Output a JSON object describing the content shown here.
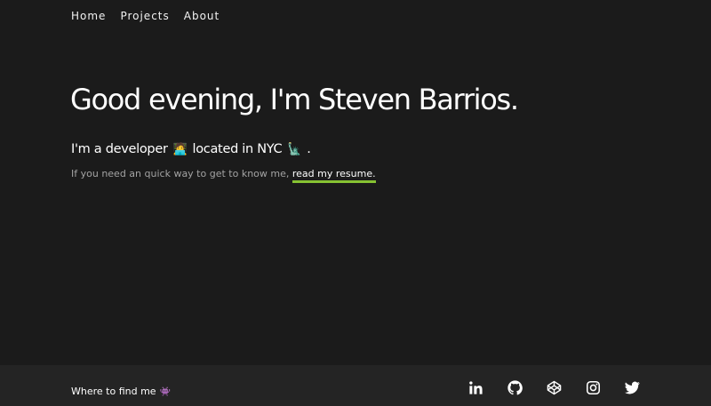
{
  "nav": {
    "items": [
      {
        "label": "Home"
      },
      {
        "label": "Projects"
      },
      {
        "label": "About"
      }
    ]
  },
  "hero": {
    "title": "Good evening, I'm Steven Barrios.",
    "subline_part1": "I'm a developer",
    "developer_emoji": "🧑‍💻",
    "subline_part2": "located in NYC",
    "nyc_emoji": "🗽",
    "subline_end": ".",
    "intro_text": "If you need an quick way to get to know me,",
    "resume_link": "read my resume."
  },
  "footer": {
    "find_me_label": "Where to find me",
    "find_me_emoji": "👾",
    "social_icons": [
      "linkedin-icon",
      "github-icon",
      "codepen-icon",
      "instagram-icon",
      "twitter-icon"
    ]
  },
  "colors": {
    "background": "#1b1b1b",
    "footer_background": "#242424",
    "accent_underline": "#86c232",
    "muted_text": "#a3a3a3"
  }
}
